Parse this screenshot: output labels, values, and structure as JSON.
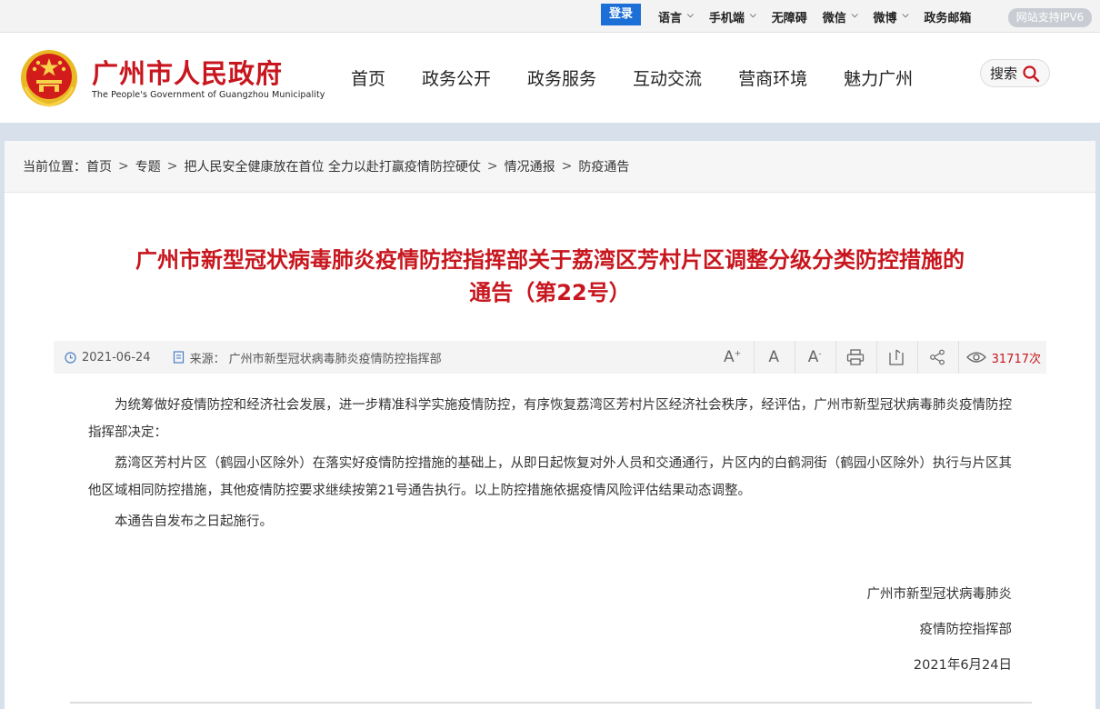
{
  "topbar": {
    "login": "登录",
    "links": [
      {
        "label": "语言",
        "has_dropdown": true
      },
      {
        "label": "手机端",
        "has_dropdown": true
      },
      {
        "label": "无障碍",
        "has_dropdown": false
      },
      {
        "label": "微信",
        "has_dropdown": true
      },
      {
        "label": "微博",
        "has_dropdown": true
      },
      {
        "label": "政务邮箱",
        "has_dropdown": false
      }
    ],
    "ipv6": "网站支持IPV6"
  },
  "header": {
    "title": "广州市人民政府",
    "subtitle": "The People's Government of Guangzhou Municipality",
    "nav": [
      "首页",
      "政务公开",
      "政务服务",
      "互动交流",
      "营商环境",
      "魅力广州"
    ],
    "search_label": "搜索"
  },
  "breadcrumb": {
    "prefix": "当前位置：",
    "items": [
      "首页",
      "专题",
      "把人民安全健康放在首位 全力以赴打赢疫情防控硬仗",
      "情况通报",
      "防疫通告"
    ]
  },
  "article": {
    "title_line1": "广州市新型冠状病毒肺炎疫情防控指挥部关于荔湾区芳村片区调整分级分类防控措施的",
    "title_line2": "通告（第22号）",
    "date": "2021-06-24",
    "source_label": "来源：",
    "source": "广州市新型冠状病毒肺炎疫情防控指挥部",
    "views": "31717次",
    "paragraphs": [
      "为统筹做好疫情防控和经济社会发展，进一步精准科学实施疫情防控，有序恢复荔湾区芳村片区经济社会秩序，经评估，广州市新型冠状病毒肺炎疫情防控指挥部决定：",
      "荔湾区芳村片区（鹤园小区除外）在落实好疫情防控措施的基础上，从即日起恢复对外人员和交通通行，片区内的白鹤洞街（鹤园小区除外）执行与片区其他区域相同防控措施，其他疫情防控要求继续按第21号通告执行。以上防控措施依据疫情风险评估结果动态调整。",
      "本通告自发布之日起施行。"
    ],
    "signature": [
      "广州市新型冠状病毒肺炎",
      "疫情防控指挥部",
      "2021年6月24日"
    ]
  },
  "colors": {
    "brand_red": "#c8161e",
    "login_blue": "#1c6fd6"
  },
  "icons": [
    "clock-icon",
    "document-icon",
    "font-increase-icon",
    "font-reset-icon",
    "font-decrease-icon",
    "print-icon",
    "bookmark-icon",
    "share-icon",
    "eye-icon",
    "search-icon",
    "chevron-down-icon"
  ]
}
